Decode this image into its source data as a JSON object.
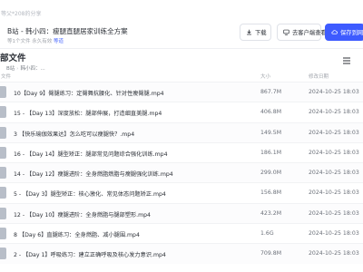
{
  "share": {
    "caption": "等父*208的分享"
  },
  "header": {
    "title": "B站 - 韩小四：瘦腿直腿居家训练全方案",
    "meta_prefix": "等1个文件",
    "meta_time": "永久有效",
    "sharer_name": "等道",
    "download_label": "下载",
    "save_cloud_label": "去客户端查看",
    "save_netdisk_label": "保存到网盘"
  },
  "section": {
    "title": "部文件"
  },
  "breadcrumb": {
    "root": "B站",
    "current": "韩小四：..."
  },
  "columns": {
    "file": "文件",
    "size": "大小",
    "time": "修改日期"
  },
  "files": [
    {
      "name": "10【Day 9】臀腿练习：定臀舞抗腰化、针对性瘦臀腿.mp4",
      "size": "867.7M",
      "time": "2024-10-25 18:03"
    },
    {
      "name": "15 - 【Day 13】深度放松：腿部伸展，打造细直美腿.mp4",
      "size": "406.8M",
      "time": "2024-10-25 18:03"
    },
    {
      "name": "3 【快乐瑜伽效果达】怎么吃可以瘦腿快？.mp4",
      "size": "149.5M",
      "time": "2024-10-25 18:03"
    },
    {
      "name": "16 - 【Day 14】腿型矫正：腿部常见问题综合强化训练.mp4",
      "size": "186.1M",
      "time": "2024-10-25 18:03"
    },
    {
      "name": "14 - 【Day 12】瘦腿进阶：全身燃脂燃脂与瘦腿强化训练.mp4",
      "size": "299.0M",
      "time": "2024-10-25 18:03"
    },
    {
      "name": "5 - 【Day 3】腿型矫正：核心激化、常见体态问题矫正.mp4",
      "size": "156.8M",
      "time": "2024-10-25 18:03"
    },
    {
      "name": "12 - 【Day 10】瘦腿进阶：全身燃脂与腿部塑形.mp4",
      "size": "423.2M",
      "time": "2024-10-25 18:03"
    },
    {
      "name": "8 【Day 6】直腿练习：全身燃脂、减小腿围.mp4",
      "size": "1.6G",
      "time": "2024-10-25 18:03"
    },
    {
      "name": "2 - 【Day 1】呼吸练习：建立正确呼吸及核心发力意识.mp4",
      "size": "709.8M",
      "time": "2024-10-25 18:03"
    }
  ]
}
